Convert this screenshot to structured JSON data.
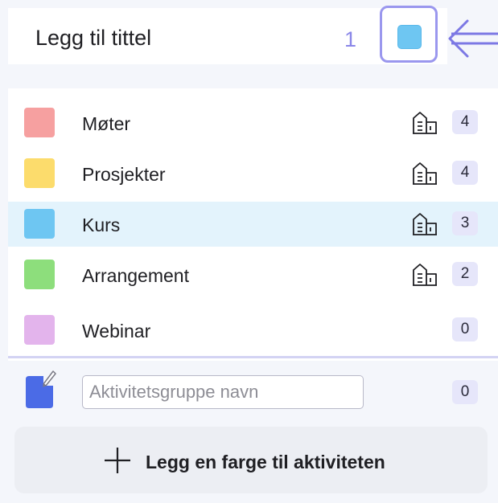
{
  "header": {
    "title": "Legg til tittel",
    "step_number": "1",
    "selected_color": "#6ec6f2"
  },
  "groups": [
    {
      "label": "Møter",
      "color": "#f6a0a0",
      "count": "4",
      "has_building_icon": true
    },
    {
      "label": "Prosjekter",
      "color": "#fcdc6c",
      "count": "4",
      "has_building_icon": true
    },
    {
      "label": "Kurs",
      "color": "#6ec6f2",
      "count": "3",
      "has_building_icon": true,
      "selected": true
    },
    {
      "label": "Arrangement",
      "color": "#8dde7c",
      "count": "2",
      "has_building_icon": true
    },
    {
      "label": "Webinar",
      "color": "#e3b4ec",
      "count": "0",
      "has_building_icon": false
    }
  ],
  "new_group": {
    "placeholder": "Aktivitetsgruppe navn",
    "value": "",
    "count": "0",
    "icon": "edit-note-icon"
  },
  "add_button": {
    "label": "Legg en farge til aktiviteten",
    "icon": "plus-icon"
  },
  "colors": {
    "accent": "#9a97ee",
    "selected_row_bg": "#e3f3fc",
    "count_badge_bg": "#e6e6fa"
  }
}
